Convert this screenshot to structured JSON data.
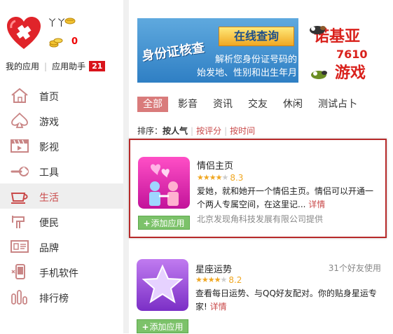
{
  "profile": {
    "username": "丫丫",
    "coins": "0"
  },
  "sidebar": {
    "my_apps": "我的应用",
    "app_helper": "应用助手",
    "helper_count": "21",
    "items": [
      {
        "label": "首页",
        "icon": "home-icon"
      },
      {
        "label": "游戏",
        "icon": "spade-icon"
      },
      {
        "label": "影视",
        "icon": "film-icon"
      },
      {
        "label": "工具",
        "icon": "wrench-icon"
      },
      {
        "label": "生活",
        "icon": "cup-icon",
        "active": true
      },
      {
        "label": "便民",
        "icon": "faucet-icon"
      },
      {
        "label": "品牌",
        "icon": "id-card-icon"
      },
      {
        "label": "手机软件",
        "icon": "phone-icon"
      },
      {
        "label": "排行榜",
        "icon": "bars-icon"
      }
    ]
  },
  "banners": {
    "id_check": {
      "title": "身份证核查",
      "button": "在线查询",
      "desc_line1": "解析您身份证号码的",
      "desc_line2": "始发地、性别和出生年月"
    },
    "nokia": {
      "title": "诺基亚",
      "number": "7610",
      "sub": "游戏"
    }
  },
  "tabs": [
    "全部",
    "影音",
    "资讯",
    "交友",
    "休闲",
    "测试占卜"
  ],
  "sort": {
    "label": "排序：",
    "current": "按人气",
    "by_rating": "按评分",
    "by_time": "按时间"
  },
  "apps": [
    {
      "name": "情侣主页",
      "score": "8.3",
      "stars": 4,
      "desc": "爱她，就和她开一个情侣主页。情侣可以开通一个两人专属空间，在这里记...",
      "detail": "详情",
      "provider": "北京发现角科技发展有限公司提供",
      "add": "添加应用"
    },
    {
      "name": "星座运势",
      "users": "31个好友使用",
      "score": "8.2",
      "stars": 4,
      "desc": "查看每日运势、与QQ好友配对。你的贴身星运专家!",
      "detail": "详情",
      "add": "添加应用"
    }
  ],
  "colors": {
    "accent_red": "#c94a4a",
    "badge_red": "#d9141b",
    "tab_active": "#d97b7b",
    "add_green": "#7cc26a",
    "star_orange": "#f0a722"
  }
}
